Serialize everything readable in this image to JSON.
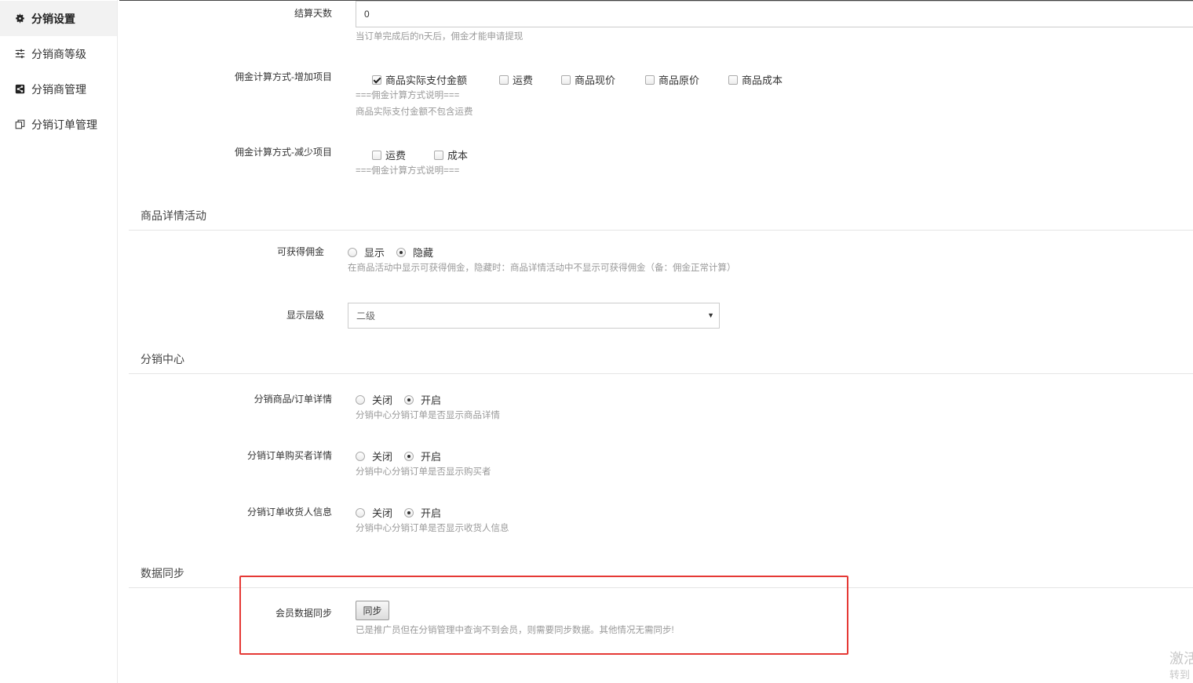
{
  "sidebar": {
    "items": [
      {
        "label": "分销设置",
        "icon": "gear-icon",
        "active": true
      },
      {
        "label": "分销商等级",
        "icon": "sliders-icon",
        "active": false
      },
      {
        "label": "分销商管理",
        "icon": "share-icon",
        "active": false
      },
      {
        "label": "分销订单管理",
        "icon": "copy-icon",
        "active": false
      }
    ]
  },
  "settlement": {
    "label": "结算天数",
    "value": "0",
    "help": "当订单完成后的n天后，佣金才能申请提现"
  },
  "commission_add": {
    "label": "佣金计算方式-增加项目",
    "options": [
      {
        "label": "商品实际支付金额",
        "checked": true
      },
      {
        "label": "运费",
        "checked": false
      },
      {
        "label": "商品现价",
        "checked": false
      },
      {
        "label": "商品原价",
        "checked": false
      },
      {
        "label": "商品成本",
        "checked": false
      }
    ],
    "help1": "===佣金计算方式说明===",
    "help2": "商品实际支付金额不包含运费"
  },
  "commission_reduce": {
    "label": "佣金计算方式-减少项目",
    "options": [
      {
        "label": "运费",
        "checked": false
      },
      {
        "label": "成本",
        "checked": false
      }
    ],
    "help": "===佣金计算方式说明==="
  },
  "section_product": {
    "title": "商品详情活动",
    "commission_visible": {
      "label": "可获得佣金",
      "options": [
        {
          "label": "显示",
          "checked": false
        },
        {
          "label": "隐藏",
          "checked": true
        }
      ],
      "help": "在商品活动中显示可获得佣金，隐藏时：商品详情活动中不显示可获得佣金（备：佣金正常计算）"
    },
    "display_level": {
      "label": "显示层级",
      "selected": "二级"
    }
  },
  "section_center": {
    "title": "分销中心",
    "rows": [
      {
        "label": "分销商品/订单详情",
        "options": [
          {
            "label": "关闭",
            "checked": false
          },
          {
            "label": "开启",
            "checked": true
          }
        ],
        "help": "分销中心分销订单是否显示商品详情"
      },
      {
        "label": "分销订单购买者详情",
        "options": [
          {
            "label": "关闭",
            "checked": false
          },
          {
            "label": "开启",
            "checked": true
          }
        ],
        "help": "分销中心分销订单是否显示购买者"
      },
      {
        "label": "分销订单收货人信息",
        "options": [
          {
            "label": "关闭",
            "checked": false
          },
          {
            "label": "开启",
            "checked": true
          }
        ],
        "help": "分销中心分销订单是否显示收货人信息"
      }
    ]
  },
  "section_sync": {
    "title": "数据同步",
    "member_sync": {
      "label": "会员数据同步",
      "button": "同步",
      "help": "已是推广员但在分销管理中查询不到会员，则需要同步数据。其他情况无需同步!"
    },
    "highlight_color": "#e53935"
  },
  "watermark": {
    "line1": "激活",
    "line2": "转到"
  }
}
